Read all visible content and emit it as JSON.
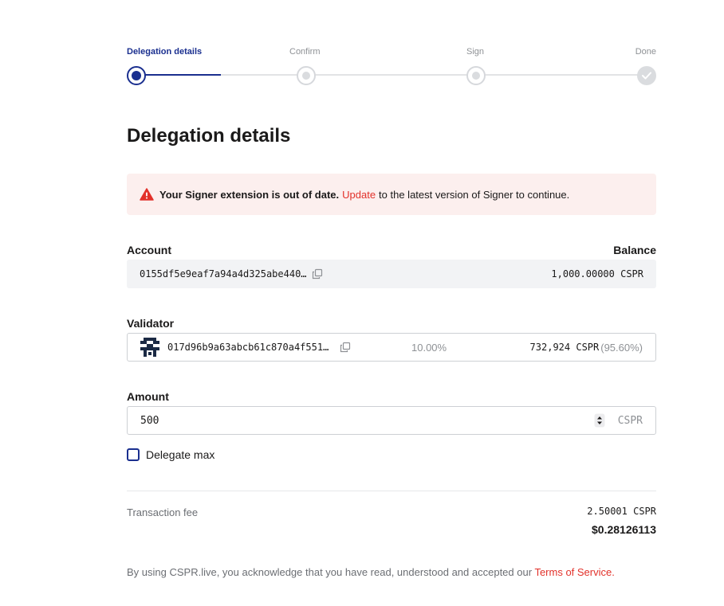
{
  "stepper": {
    "steps": [
      {
        "label": "Delegation details",
        "state": "active"
      },
      {
        "label": "Confirm",
        "state": "pending"
      },
      {
        "label": "Sign",
        "state": "pending"
      },
      {
        "label": "Done",
        "state": "pending"
      }
    ]
  },
  "page": {
    "title": "Delegation details"
  },
  "alert": {
    "icon": "warning-triangle-icon",
    "strong_text": "Your Signer extension is out of date.",
    "link_text": "Update",
    "rest_text": "to the latest version of Signer to continue."
  },
  "account": {
    "label": "Account",
    "balance_label": "Balance",
    "key": "0155df5e9eaf7a94a4d325abe440…",
    "balance": "1,000.00000 CSPR"
  },
  "validator": {
    "label": "Validator",
    "key": "017d96b9a63abcb61c870a4f551…",
    "fee": "10.00%",
    "stake": "732,924 CSPR",
    "stake_pct": "(95.60%)"
  },
  "amount": {
    "label": "Amount",
    "value": "500",
    "currency": "CSPR"
  },
  "delegate_max": {
    "label": "Delegate max",
    "checked": false
  },
  "fee": {
    "label": "Transaction fee",
    "cspr": "2.50001 CSPR",
    "usd": "$0.28126113"
  },
  "footer": {
    "text": "By using CSPR.live, you acknowledge that you have read, understood and accepted our",
    "link_text": "Terms of Service."
  },
  "colors": {
    "primary": "#1a2f8f",
    "danger": "#e2312a",
    "alert_bg": "#fcefee",
    "muted": "#8e9195"
  }
}
